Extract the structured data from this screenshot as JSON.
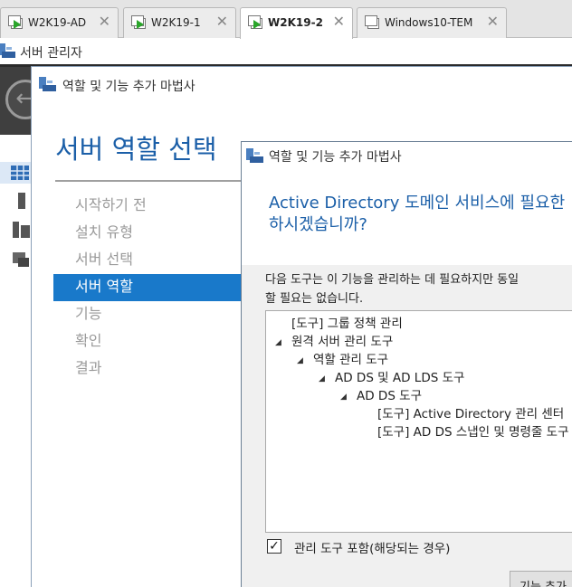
{
  "tabs": [
    {
      "label": "W2K19-AD",
      "active": false
    },
    {
      "label": "W2K19-1",
      "active": false
    },
    {
      "label": "W2K19-2",
      "active": true
    },
    {
      "label": "Windows10-TEM",
      "active": false
    }
  ],
  "server_manager": {
    "title": "서버 관리자"
  },
  "wizard": {
    "title": "역할 및 기능 추가 마법사",
    "heading": "서버 역할 선택",
    "steps": [
      "시작하기 전",
      "설치 유형",
      "서버 선택",
      "서버 역할",
      "기능",
      "확인",
      "결과"
    ],
    "active_step": "서버 역할"
  },
  "dialog": {
    "title": "역할 및 기능 추가 마법사",
    "question_line1": "Active Directory 도메인 서비스에 필요한",
    "question_line2": "하시겠습니까?",
    "desc_line1": "다음 도구는 이 기능을 관리하는 데 필요하지만 동일",
    "desc_line2": "할 필요는 없습니다.",
    "tree": [
      "[도구] 그룹 정책 관리",
      "원격 서버 관리 도구",
      "역할 관리 도구",
      "AD DS 및 AD LDS 도구",
      "AD DS 도구",
      "[도구] Active Directory 관리 센터",
      "[도구] AD DS 스냅인 및 명령줄 도구"
    ],
    "include_tools_label": "관리 도구 포함(해당되는 경우)",
    "include_tools_checked": true,
    "add_button": "기능 추가"
  },
  "colors": {
    "accent": "#1979ca",
    "heading": "#1b5fa8",
    "dark_band": "#3f3f3f"
  }
}
